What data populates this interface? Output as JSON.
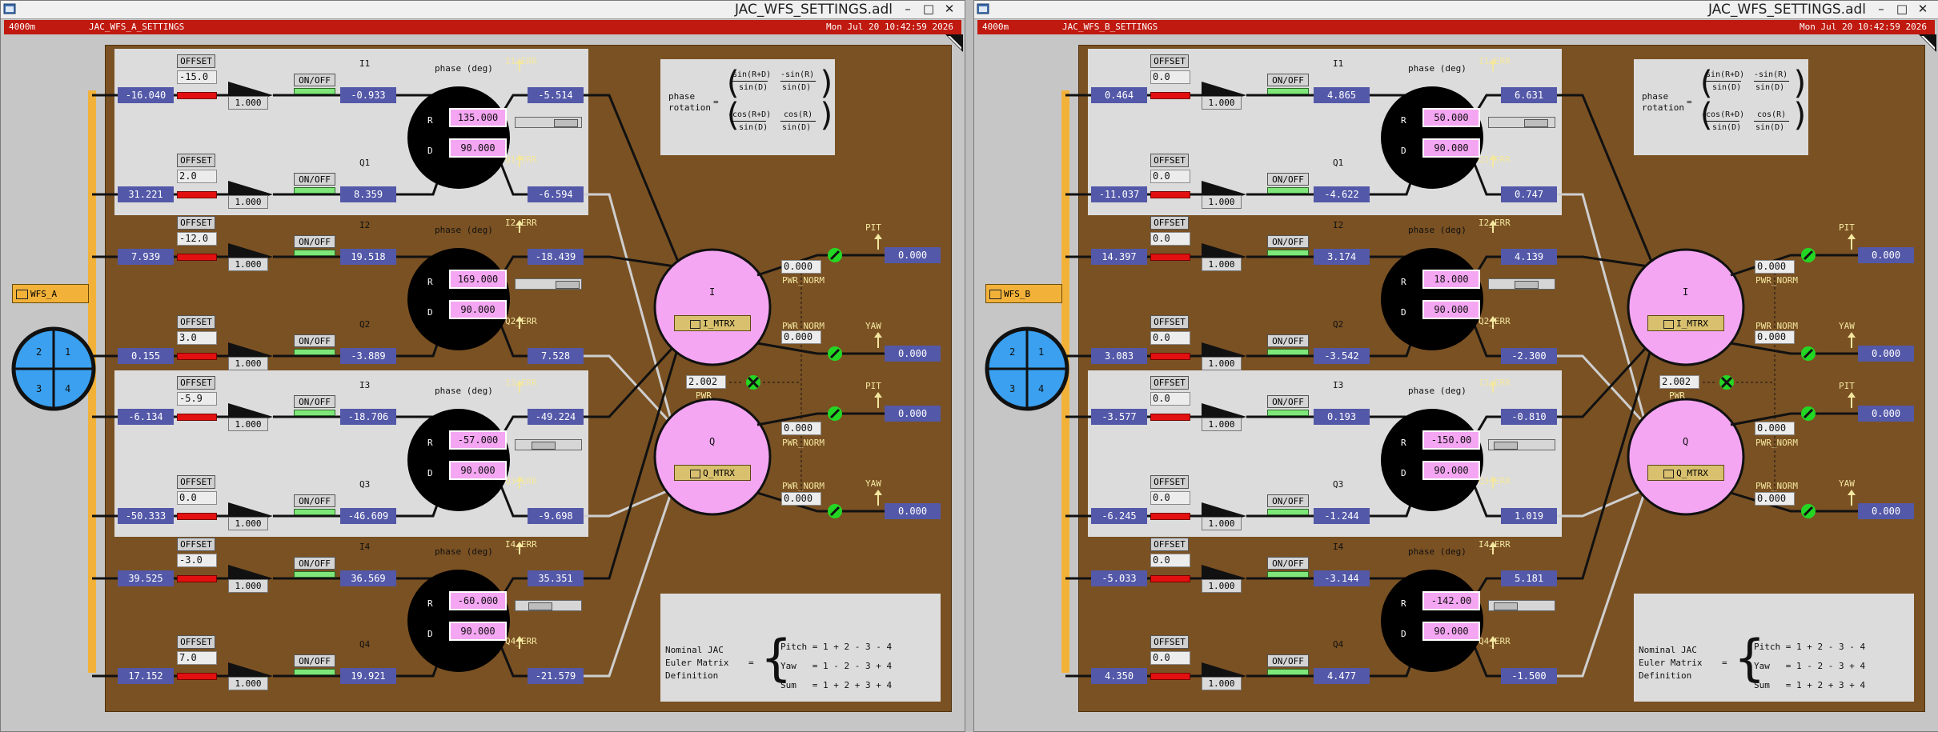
{
  "icons": {
    "window": "window-icon",
    "minimize": "minimize-icon",
    "maximize": "maximize-icon",
    "close": "close-icon",
    "dialog": "related-display-icon",
    "status_ok": "green-status-icon",
    "status_bad": "red-x-icon",
    "arrow": "up-arrow-icon",
    "corner": "resize-corner-icon"
  },
  "colors": {
    "status_bar": "#c0190f",
    "background": "#7a5123",
    "readback": "#5358a8",
    "setpoint": "#f4a6f2",
    "on": "#7fe67a",
    "offset_bar": "#e21010",
    "quad": "#3aa0ef",
    "wfs_button": "#f2b23a"
  },
  "windows": [
    {
      "title": "JAC_WFS_SETTINGS.adl",
      "status": {
        "left": "4000m",
        "name": "JAC_WFS_A_SETTINGS",
        "time": "Mon Jul 20 10:42:59 2026"
      },
      "wfs_button": "WFS_A",
      "quadrants": [
        "2",
        "1",
        "3",
        "4"
      ],
      "phase_label": "phase (deg)",
      "offset_label": "OFFSET",
      "onoff_label": "ON/OFF",
      "R": "R",
      "D": "D",
      "channels": [
        {
          "input": "-16.040",
          "offset": "-15.0",
          "gain": "1.000",
          "name": "I1",
          "output": "-0.933",
          "err_label": "I1_ERR",
          "err": "-5.514"
        },
        {
          "input": "31.221",
          "offset": "2.0",
          "gain": "1.000",
          "name": "Q1",
          "output": "8.359",
          "err_label": "Q1_ERR",
          "err": "-6.594"
        },
        {
          "input": "7.939",
          "offset": "-12.0",
          "gain": "1.000",
          "name": "I2",
          "output": "19.518",
          "err_label": "I2_ERR",
          "err": "-18.439"
        },
        {
          "input": "0.155",
          "offset": "3.0",
          "gain": "1.000",
          "name": "Q2",
          "output": "-3.889",
          "err_label": "Q2_ERR",
          "err": "7.528"
        },
        {
          "input": "-6.134",
          "offset": "-5.9",
          "gain": "1.000",
          "name": "I3",
          "output": "-18.706",
          "err_label": "I3_ERR",
          "err": "-49.224"
        },
        {
          "input": "-50.333",
          "offset": "0.0",
          "gain": "1.000",
          "name": "Q3",
          "output": "-46.609",
          "err_label": "Q3_ERR",
          "err": "-9.698"
        },
        {
          "input": "39.525",
          "offset": "-3.0",
          "gain": "1.000",
          "name": "I4",
          "output": "36.569",
          "err_label": "I4_ERR",
          "err": "35.351"
        },
        {
          "input": "17.152",
          "offset": "7.0",
          "gain": "1.000",
          "name": "Q4",
          "output": "19.921",
          "err_label": "Q4_ERR",
          "err": "-21.579"
        }
      ],
      "phases": [
        {
          "R": "135.000",
          "D": "90.000"
        },
        {
          "R": "169.000",
          "D": "90.000"
        },
        {
          "R": "-57.000",
          "D": "90.000"
        },
        {
          "R": "-60.000",
          "D": "90.000"
        }
      ],
      "I_label": "I",
      "Q_label": "Q",
      "I_mtrx": "I_MTRX",
      "Q_mtrx": "Q_MTRX",
      "pwr": "2.002",
      "pwr_label": "PWR",
      "pwr_norm_label": "PWR_NORM",
      "norms": [
        "0.000",
        "0.000",
        "0.000",
        "0.000"
      ],
      "pit_label": "PIT",
      "yaw_label": "YAW",
      "outputs": {
        "i_pit": "0.000",
        "i_yaw": "0.000",
        "q_pit": "0.000",
        "q_yaw": "0.000"
      },
      "rotation": {
        "label1": "phase",
        "label2": "rotation",
        "eq": "=",
        "m11n": "sin(R+D)",
        "m11d": "sin(D)",
        "m12n": "-sin(R)",
        "m12d": "sin(D)",
        "m21n": "-cos(R+D)",
        "m21d": "sin(D)",
        "m22n": "cos(R)",
        "m22d": "sin(D)"
      },
      "euler": {
        "l1": "Nominal JAC",
        "l2": "Euler Matrix",
        "l3": "Definition",
        "eq": "=",
        "r1": "Pitch = 1 + 2 - 3 - 4",
        "r2": "Yaw   = 1 - 2 - 3 + 4",
        "r3": "Sum   = 1 + 2 + 3 + 4"
      }
    },
    {
      "title": "JAC_WFS_SETTINGS.adl",
      "status": {
        "left": "4000m",
        "name": "JAC_WFS_B_SETTINGS",
        "time": "Mon Jul 20 10:42:59 2026"
      },
      "wfs_button": "WFS_B",
      "quadrants": [
        "2",
        "1",
        "3",
        "4"
      ],
      "phase_label": "phase (deg)",
      "offset_label": "OFFSET",
      "onoff_label": "ON/OFF",
      "R": "R",
      "D": "D",
      "channels": [
        {
          "input": "0.464",
          "offset": "0.0",
          "gain": "1.000",
          "name": "I1",
          "output": "4.865",
          "err_label": "I1_ERR",
          "err": "6.631"
        },
        {
          "input": "-11.037",
          "offset": "0.0",
          "gain": "1.000",
          "name": "Q1",
          "output": "-4.622",
          "err_label": "Q1_ERR",
          "err": "0.747"
        },
        {
          "input": "14.397",
          "offset": "0.0",
          "gain": "1.000",
          "name": "I2",
          "output": "3.174",
          "err_label": "I2_ERR",
          "err": "4.139"
        },
        {
          "input": "3.083",
          "offset": "0.0",
          "gain": "1.000",
          "name": "Q2",
          "output": "-3.542",
          "err_label": "Q2_ERR",
          "err": "-2.300"
        },
        {
          "input": "-3.577",
          "offset": "0.0",
          "gain": "1.000",
          "name": "I3",
          "output": "0.193",
          "err_label": "I3_ERR",
          "err": "-0.810"
        },
        {
          "input": "-6.245",
          "offset": "0.0",
          "gain": "1.000",
          "name": "Q3",
          "output": "-1.244",
          "err_label": "Q3_ERR",
          "err": "1.019"
        },
        {
          "input": "-5.033",
          "offset": "0.0",
          "gain": "1.000",
          "name": "I4",
          "output": "-3.144",
          "err_label": "I4_ERR",
          "err": "5.181"
        },
        {
          "input": "4.350",
          "offset": "0.0",
          "gain": "1.000",
          "name": "Q4",
          "output": "4.477",
          "err_label": "Q4_ERR",
          "err": "-1.500"
        }
      ],
      "phases": [
        {
          "R": "50.000",
          "D": "90.000"
        },
        {
          "R": "18.000",
          "D": "90.000"
        },
        {
          "R": "-150.00",
          "D": "90.000"
        },
        {
          "R": "-142.00",
          "D": "90.000"
        }
      ],
      "I_label": "I",
      "Q_label": "Q",
      "I_mtrx": "I_MTRX",
      "Q_mtrx": "Q_MTRX",
      "pwr": "2.002",
      "pwr_label": "PWR",
      "pwr_norm_label": "PWR_NORM",
      "norms": [
        "0.000",
        "0.000",
        "0.000",
        "0.000"
      ],
      "pit_label": "PIT",
      "yaw_label": "YAW",
      "outputs": {
        "i_pit": "0.000",
        "i_yaw": "0.000",
        "q_pit": "0.000",
        "q_yaw": "0.000"
      },
      "rotation": {
        "label1": "phase",
        "label2": "rotation",
        "eq": "=",
        "m11n": "sin(R+D)",
        "m11d": "sin(D)",
        "m12n": "-sin(R)",
        "m12d": "sin(D)",
        "m21n": "-cos(R+D)",
        "m21d": "sin(D)",
        "m22n": "cos(R)",
        "m22d": "sin(D)"
      },
      "euler": {
        "l1": "Nominal JAC",
        "l2": "Euler Matrix",
        "l3": "Definition",
        "eq": "=",
        "r1": "Pitch = 1 + 2 - 3 - 4",
        "r2": "Yaw   = 1 - 2 - 3 + 4",
        "r3": "Sum   = 1 + 2 + 3 + 4"
      }
    }
  ]
}
